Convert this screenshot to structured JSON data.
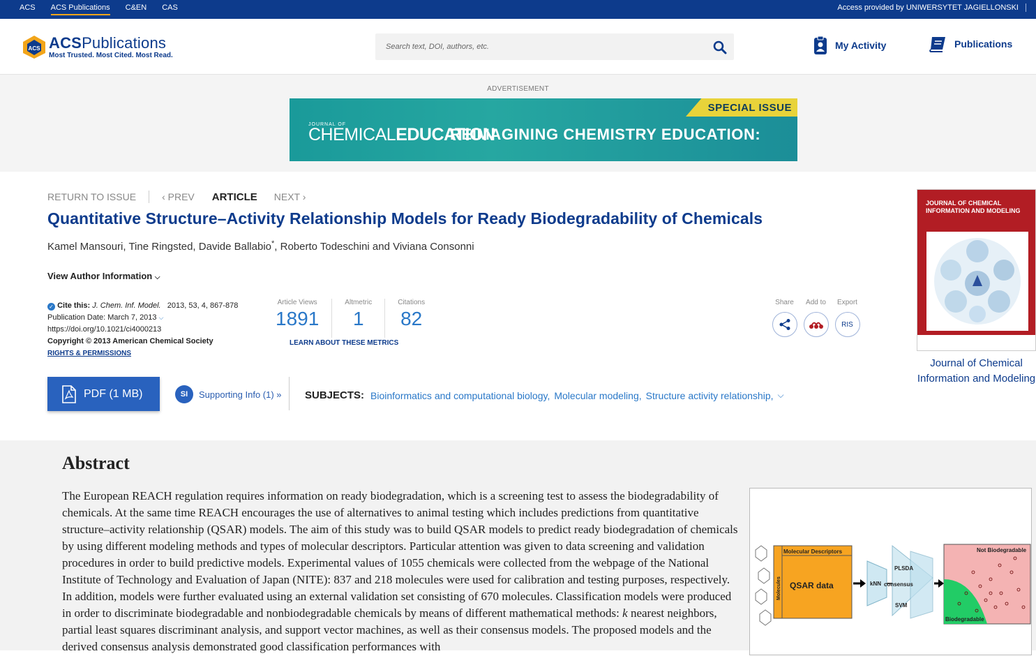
{
  "topbar": {
    "links": [
      "ACS",
      "ACS Publications",
      "C&EN",
      "CAS"
    ],
    "active_link": "ACS Publications",
    "access_text": "Access provided by UNIWERSYTET JAGIELLONSKI"
  },
  "header": {
    "logo_main": "ACSPublications",
    "logo_tagline": "Most Trusted. Most Cited. Most Read.",
    "search_placeholder": "Search text, DOI, authors, etc.",
    "my_activity": "My Activity",
    "publications": "Publications"
  },
  "ad": {
    "label": "ADVERTISEMENT",
    "ribbon": "SPECIAL ISSUE",
    "journal_small": "JOURNAL OF",
    "journal_large": "CHEMICALEDUCATION",
    "headline": "REIMAGINING CHEMISTRY EDUCATION:"
  },
  "article": {
    "nav": {
      "return": "RETURN TO ISSUE",
      "prev": "PREV",
      "current": "ARTICLE",
      "next": "NEXT"
    },
    "title": "Quantitative Structure–Activity Relationship Models for Ready Biodegradability of Chemicals",
    "authors_a": "Kamel Mansouri, Tine Ringsted, Davide Ballabio",
    "authors_sup": "*",
    "authors_b": ", Roberto Todeschini and Viviana Consonni",
    "view_author": "View Author Information",
    "cite_label": "Cite this:",
    "cite_journal": "J. Chem. Inf. Model.",
    "cite_ref": "2013, 53, 4, 867-878",
    "pub_date": "Publication Date: March 7, 2013",
    "doi": "https://doi.org/10.1021/ci4000213",
    "copyright": "Copyright © 2013 American Chemical Society",
    "rights": "RIGHTS & PERMISSIONS",
    "metrics": [
      {
        "label": "Article Views",
        "value": "1891"
      },
      {
        "label": "Altmetric",
        "value": "1"
      },
      {
        "label": "Citations",
        "value": "82"
      }
    ],
    "learn_metrics": "LEARN ABOUT THESE METRICS",
    "tools": [
      {
        "label": "Share",
        "icon": "share-icon"
      },
      {
        "label": "Add to",
        "icon": "mendeley-icon"
      },
      {
        "label": "Export",
        "text": "RIS"
      }
    ],
    "pdf_label": "PDF (1 MB)",
    "si_badge": "SI",
    "si_label": "Supporting Info (1) »",
    "subjects_label": "SUBJECTS:",
    "subjects": [
      "Bioinformatics and computational biology,",
      "Molecular modeling,",
      "Structure activity relationship,"
    ],
    "journal_name": "Journal of Chemical Information and Modeling",
    "cover_title": "JOURNAL OF CHEMICAL INFORMATION AND MODELING"
  },
  "abstract": {
    "heading": "Abstract",
    "text_a": "The European REACH regulation requires information on ready biodegradation, which is a screening test to assess the biodegradability of chemicals. At the same time REACH encourages the use of alternatives to animal testing which includes predictions from quantitative structure–activity relationship (QSAR) models. The aim of this study was to build QSAR models to predict ready biodegradation of chemicals by using different modeling methods and types of molecular descriptors. Particular attention was given to data screening and validation procedures in order to build predictive models. Experimental values of 1055 chemicals were collected from the webpage of the National Institute of Technology and Evaluation of Japan (NITE): 837 and 218 molecules were used for calibration and testing purposes, respectively. In addition, models were further evaluated using an external validation set consisting of 670 molecules. Classification models were produced in order to discriminate biodegradable and nonbiodegradable chemicals by means of different mathematical methods: ",
    "text_k": "k",
    "text_b": " nearest neighbors, partial least squares discriminant analysis, and support vector machines, as well as their consensus models. The proposed models and the derived consensus analysis demonstrated good classification performances with",
    "toc": {
      "descriptors": "Molecular Descriptors",
      "molecules": "Molecules",
      "qsar": "QSAR data",
      "plsda": "PLSDA",
      "knn": "kNN",
      "consensus": "consensus",
      "svm": "SVM",
      "not_biodeg": "Not Biodegradable",
      "biodeg": "Biodegradable"
    }
  }
}
